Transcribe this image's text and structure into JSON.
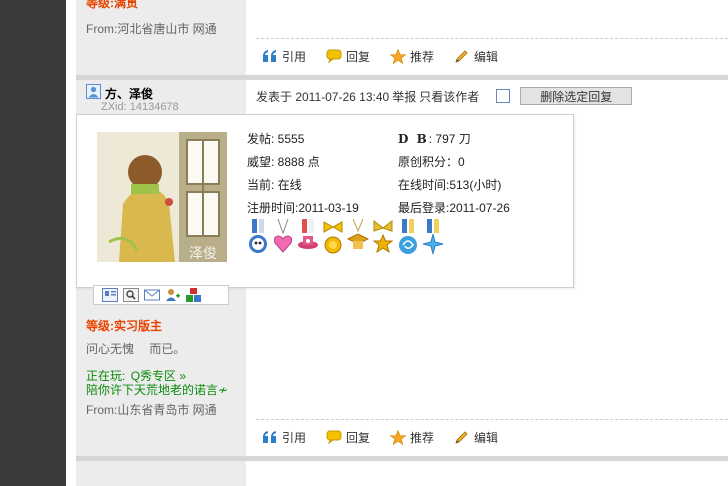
{
  "prev_post": {
    "level_text": "等级:满贯",
    "from_text": "From:河北省唐山市 网通",
    "actions": {
      "quote": "引用",
      "reply": "回复",
      "recommend": "推荐",
      "edit": "编辑"
    }
  },
  "post": {
    "username": "方、泽俊",
    "zxid": "ZXid: 14134678",
    "posted_at": "发表于 2011-07-26 13:40",
    "report": "举报",
    "only_author": "只看该作者",
    "delete_selected": "删除选定回复",
    "level_text": "等级:实习版主",
    "signature_a": "问心无愧",
    "signature_b": "而已。",
    "playing_label": "正在玩:",
    "playing_link": "Q秀专区 »",
    "playing_desc": "陪你许下天荒地老的诺言≁",
    "from_text": "From:山东省青岛市 网通",
    "actions": {
      "quote": "引用",
      "reply": "回复",
      "recommend": "推荐",
      "edit": "编辑"
    }
  },
  "profile_popup": {
    "avatar_watermark": "泽俊",
    "posts": "发帖: 5555",
    "db_label": "D B",
    "db_value": ": 797 刀",
    "prestige": "威望: 8888 点",
    "original_points": "原创积分：0",
    "current": "当前: 在线",
    "online_time": "在线时间:513(小时)",
    "register_time": "注册时间:2011-03-19",
    "last_login": "最后登录:2011-07-26"
  },
  "colors": {
    "level": "#e84400",
    "link_green": "#0a8a0a",
    "sidebar_bg": "#ececec",
    "left_strip": "#3b3b3b"
  },
  "icons": [
    "quote-icon",
    "reply-icon",
    "recommend-star-icon",
    "edit-pencil-icon",
    "user-icon",
    "profile-icon",
    "search-icon",
    "message-icon",
    "add-friend-icon",
    "blocks-icon"
  ],
  "medal_count": 8
}
